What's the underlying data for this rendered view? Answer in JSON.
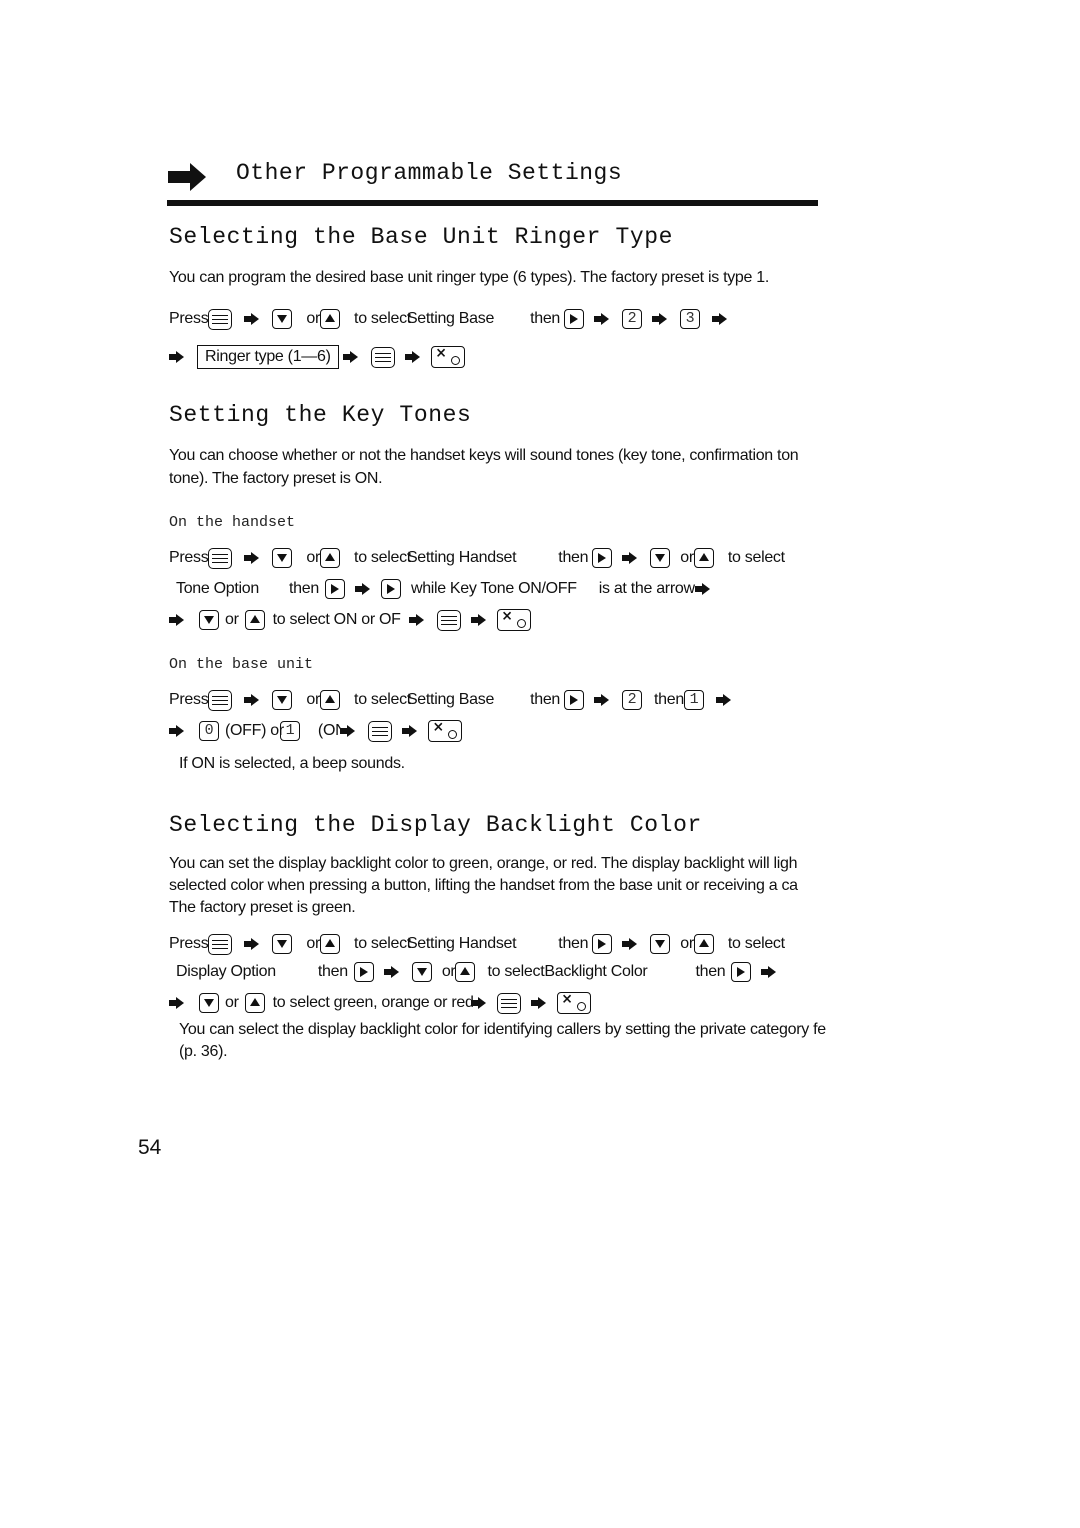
{
  "header": {
    "title": "Other Programmable Settings",
    "icon": "arrow-right-icon"
  },
  "sections": {
    "ringer": {
      "heading": "Selecting the Base Unit Ringer Type",
      "description": "You can program the desired base unit ringer type (6 types). The factory preset is type 1.",
      "step1": {
        "press": "Press",
        "or": "or",
        "to_select": "to select",
        "target": "Setting Base",
        "then": "then",
        "key_a": "2",
        "key_b": "3"
      },
      "step2": {
        "boxed": "Ringer type (1—6)"
      }
    },
    "key_tones": {
      "heading": "Setting the Key Tones",
      "description_line1": "You can choose whether or not the handset keys will sound tones (key tone, confirmation ton",
      "description_line2": "tone). The factory preset is ON.",
      "handset": {
        "subheading": "On the handset",
        "line1": {
          "press": "Press",
          "or": "or",
          "to_select": "to select",
          "target": "Setting Handset",
          "then": "then",
          "or2": "or",
          "to_select2": "to select"
        },
        "line2": {
          "option": "Tone Option",
          "then": "then",
          "while": "while",
          "item": "Key Tone ON/OFF",
          "tail": "is at the arrow"
        },
        "line3": {
          "or": "or",
          "text": "to select ON or OF"
        }
      },
      "base": {
        "subheading": "On the base unit",
        "line1": {
          "press": "Press",
          "or": "or",
          "to_select": "to select",
          "target": "Setting Base",
          "then": "then",
          "key_a": "2",
          "then2": "then",
          "key_b": "1"
        },
        "line2": {
          "key_off": "0",
          "off_label": "(OFF) or",
          "key_on": "1",
          "on_label": "(ON)"
        },
        "note": "If ON is selected, a beep sounds."
      }
    },
    "backlight": {
      "heading": "Selecting the Display Backlight Color",
      "description_line1": "You can set the display backlight color to green, orange, or red. The display backlight will ligh",
      "description_line2": "selected color when pressing a button, lifting the handset from the base unit or receiving a ca",
      "description_line3": "The factory preset is green.",
      "line1": {
        "press": "Press",
        "or": "or",
        "to_select": "to select",
        "target": "Setting Handset",
        "then": "then",
        "or2": "or",
        "to_select2": "to select"
      },
      "line2": {
        "option": "Display Option",
        "then": "then",
        "or": "or",
        "to_select": "to select",
        "item": "Backlight Color",
        "then2": "then"
      },
      "line3": {
        "or": "or",
        "text": "to select green, orange or red"
      },
      "note_line1": "You can select the display backlight color for identifying callers by setting the private category fe",
      "note_line2": "(p. 36)."
    }
  },
  "page_number": "54"
}
